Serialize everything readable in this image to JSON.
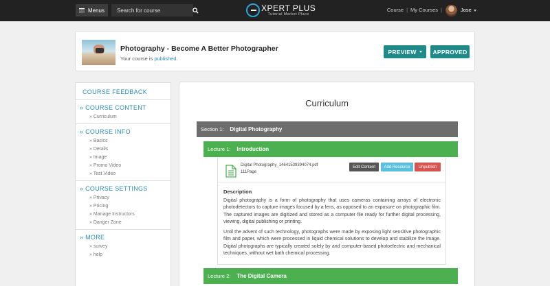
{
  "topbar": {
    "menus_label": "Menus",
    "search_placeholder": "Search for course",
    "logo_title": "XPERT PLUS",
    "logo_subtitle": "Tutorial Market Place",
    "nav_course": "Course",
    "nav_separator": "|",
    "nav_my_courses": "My Courses",
    "user_name": "Jose"
  },
  "course": {
    "title": "Photography - Become A Better Photographer",
    "status_prefix": "Your course is ",
    "status_value": "published.",
    "preview_label": "PREVIEW",
    "approved_label": "APPROVED"
  },
  "sidebar": {
    "feedback": "COURSE FEEDBACK",
    "sections": [
      {
        "head": "» COURSE CONTENT",
        "items": [
          "» Curriculum"
        ]
      },
      {
        "head": "» COURSE INFO",
        "items": [
          "» Basics",
          "» Details",
          "» Image",
          "» Promo Video",
          "» Test Video"
        ]
      },
      {
        "head": "» COURSE SETTINGS",
        "items": [
          "» Privacy",
          "» Pricing",
          "» Manage Instructors",
          "» Danger Zone"
        ]
      },
      {
        "head": "» MORE",
        "items": [
          "» survey",
          "» help"
        ]
      }
    ]
  },
  "curriculum": {
    "title": "Curriculum",
    "section1_label": "Section 1:",
    "section1_name": "Digital Photography",
    "lecture1_label": "Lecture 1:",
    "lecture1_name": "Introduction",
    "resource_name": "Digital Photography_14641539394074.pdf",
    "resource_pages": "111Page",
    "edit_label": "Edit Content",
    "add_label": "Add Resource",
    "unpublish_label": "Unpublish",
    "description_label": "Description",
    "description_p1": "Digital photography is a form of photography that uses cameras containing arrays of electronic photodetectors to capture images focused by a lens, as opposed to an exposure on photographic film. The captured images are digitized and stored as a computer file ready for further digital processing, viewing, digital publishing or printing.",
    "description_p2": "Until the advent of such technology, photographs were made by exposing light sensitive photographic film and paper, which were processed in liquid chemical solutions to develop and stabilize the image. Digital photographs are typically created solely by and computer-based photoelectric and mechanical techniques, without wet bath chemical processing.",
    "lecture2_label": "Lecture 2:",
    "lecture2_name": "The Digital Camera"
  },
  "colors": {
    "accent_teal": "#1f8a8a",
    "link_blue": "#2a8bb8",
    "lecture_green": "#4caf50",
    "section_gray": "#6d6d6d"
  }
}
